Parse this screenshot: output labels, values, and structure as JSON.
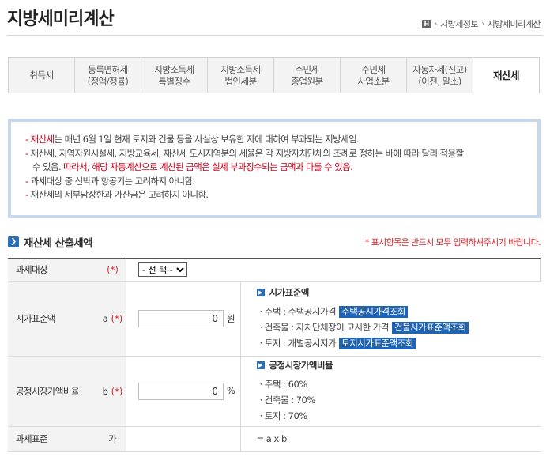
{
  "page": {
    "title": "지방세미리계산"
  },
  "breadcrumb": {
    "home": "H",
    "item1": "지방세정보",
    "item2": "지방세미리계산"
  },
  "tabs": [
    {
      "line1": "취득세",
      "line2": ""
    },
    {
      "line1": "등록면허세",
      "line2": "(정액/정률)"
    },
    {
      "line1": "지방소득세",
      "line2": "특별징수"
    },
    {
      "line1": "지방소득세",
      "line2": "법인세분"
    },
    {
      "line1": "주민세",
      "line2": "종업원분"
    },
    {
      "line1": "주민세",
      "line2": "사업소분"
    },
    {
      "line1": "자동차세(신고)",
      "line2": "(이전, 말소)"
    },
    {
      "line1": "재산세",
      "line2": "",
      "active": true
    }
  ],
  "notice": {
    "l1_dash": "- ",
    "l1_red": "재산세",
    "l1_rest": "는 매년 6월 1일 현재 토지와 건물 등을 사실상 보유한 자에 대하여 부과되는 지방세임.",
    "l2_dash": "- ",
    "l2_text": "재산세, 지역자원시설세, 지방교육세, 재산세 도시지역분의 세율은 각 지방자치단체의 조례로 정하는 바에 따라 달리 적용할",
    "l3_a": "수 있음. ",
    "l3_red": "따라서, 해당 자동계산으로 계산된 금액은 실제 부과징수되는 금액과 다를 수 있음.",
    "l4_dash": "- ",
    "l4_text": "과세대상 중 선박과 항공기는 고려하지 아니함.",
    "l5_dash": "- ",
    "l5_text": "재산세의 세부담상한과 가산금은 고려하지 아니함."
  },
  "section": {
    "title": "재산세 산출세액",
    "required_note": "* 표시항목은 반드시 모두 입력하셔주시기 바랍니다."
  },
  "form": {
    "row1": {
      "label": "과세대상",
      "symbol": "",
      "star": "(*)",
      "select_value": "- 선 택 -"
    },
    "row2": {
      "label": "시가표준액",
      "symbol": "a",
      "star": "(*)",
      "value": "0",
      "unit": "원",
      "desc_title": "시가표준액",
      "d1_text": "· 주택 : 주택공시가격",
      "d1_btn": "주택공시가격조회",
      "d2_text": "· 건축물 : 자치단체장이 고시한 가격",
      "d2_btn": "건물시가표준액조회",
      "d3_text": "· 토지 : 개별공시지가",
      "d3_btn": "토지시가표준액조회"
    },
    "row3": {
      "label": "공정시장가액비율",
      "symbol": "b",
      "star": "(*)",
      "value": "0",
      "unit": "%",
      "desc_title": "공정시장가액비율",
      "d1": "· 주택 : 60%",
      "d2": "· 건축물 : 70%",
      "d3": "· 토지 : 70%"
    },
    "row4": {
      "label": "과세표준",
      "symbol": "가",
      "formula": "= a x b"
    }
  },
  "colors": {
    "accent": "#1e63b4",
    "required": "#e0242b",
    "notice_border": "#c8d8ea"
  }
}
